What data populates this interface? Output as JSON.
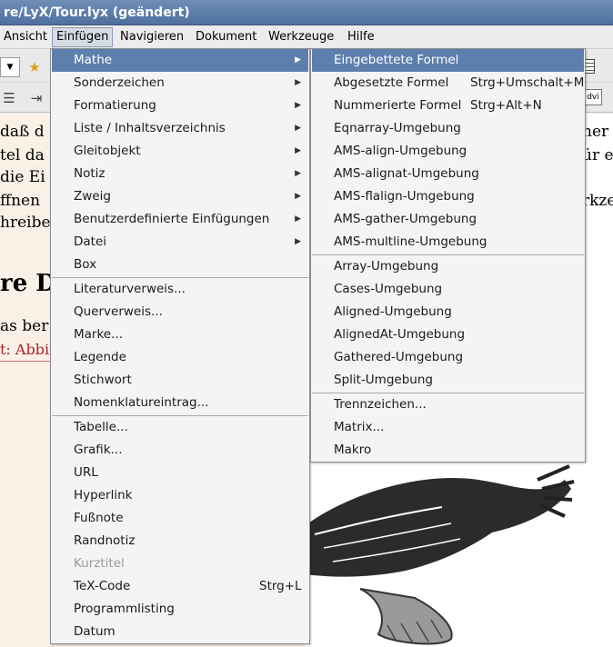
{
  "window": {
    "title": "re/LyX/Tour.lyx (geändert)"
  },
  "menubar": {
    "items": [
      "Ansicht",
      "Einfügen",
      "Navigieren",
      "Dokument",
      "Werkzeuge",
      "Hilfe"
    ]
  },
  "toolbar": {
    "dvi_label": "dvi"
  },
  "document": {
    "lines_left": [
      "daß d",
      "tel da",
      "die Ei",
      "ffnen",
      "hreibe"
    ],
    "lines_right": [
      "ner",
      "ür e",
      "",
      "rkze"
    ],
    "heading": "re D",
    "para": "as ber",
    "caption": "t: Abbi"
  },
  "menu_main": {
    "items": [
      {
        "label": "Mathe",
        "submenu": true,
        "highlighted": true
      },
      {
        "label": "Sonderzeichen",
        "submenu": true
      },
      {
        "label": "Formatierung",
        "submenu": true
      },
      {
        "label": "Liste / Inhaltsverzeichnis",
        "submenu": true
      },
      {
        "label": "Gleitobjekt",
        "submenu": true
      },
      {
        "label": "Notiz",
        "submenu": true
      },
      {
        "label": "Zweig",
        "submenu": true
      },
      {
        "label": "Benutzerdefinierte Einfügungen",
        "submenu": true
      },
      {
        "label": "Datei",
        "submenu": true
      },
      {
        "label": "Box"
      },
      {
        "label": "Literaturverweis..."
      },
      {
        "label": "Querverweis..."
      },
      {
        "label": "Marke..."
      },
      {
        "label": "Legende"
      },
      {
        "label": "Stichwort"
      },
      {
        "label": "Nomenklatureintrag..."
      },
      {
        "label": "Tabelle..."
      },
      {
        "label": "Grafik..."
      },
      {
        "label": "URL"
      },
      {
        "label": "Hyperlink"
      },
      {
        "label": "Fußnote"
      },
      {
        "label": "Randnotiz"
      },
      {
        "label": "Kurztitel",
        "disabled": true
      },
      {
        "label": "TeX-Code",
        "shortcut": "Strg+L"
      },
      {
        "label": "Programmlisting"
      },
      {
        "label": "Datum"
      }
    ]
  },
  "menu_sub": {
    "items": [
      {
        "label": "Eingebettete Formel",
        "highlighted": true
      },
      {
        "label": "Abgesetzte Formel",
        "shortcut": "Strg+Umschalt+M"
      },
      {
        "label": "Nummerierte Formel",
        "shortcut": "Strg+Alt+N"
      },
      {
        "label": "Eqnarray-Umgebung"
      },
      {
        "label": "AMS-align-Umgebung"
      },
      {
        "label": "AMS-alignat-Umgebung"
      },
      {
        "label": "AMS-flalign-Umgebung"
      },
      {
        "label": "AMS-gather-Umgebung"
      },
      {
        "label": "AMS-multline-Umgebung"
      },
      {
        "label": "Array-Umgebung"
      },
      {
        "label": "Cases-Umgebung"
      },
      {
        "label": "Aligned-Umgebung"
      },
      {
        "label": "AlignedAt-Umgebung"
      },
      {
        "label": "Gathered-Umgebung"
      },
      {
        "label": "Split-Umgebung"
      },
      {
        "label": "Trennzeichen..."
      },
      {
        "label": "Matrix..."
      },
      {
        "label": "Makro"
      }
    ]
  },
  "colors": {
    "highlight": "#5d7fad",
    "document_bg": "#faf0e6",
    "caption": "#b0202a"
  }
}
